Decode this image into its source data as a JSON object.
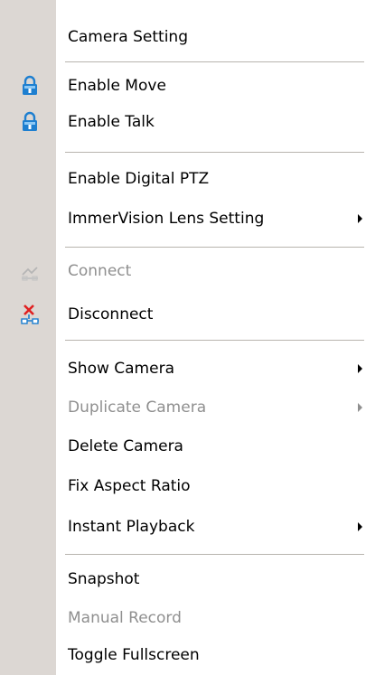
{
  "menu": {
    "items": [
      {
        "label": "Camera Setting"
      },
      {
        "label": "Enable Move",
        "icon": "lock-icon"
      },
      {
        "label": "Enable Talk",
        "icon": "lock-icon"
      },
      {
        "label": "Enable Digital PTZ"
      },
      {
        "label": "ImmerVision Lens Setting",
        "submenu": true
      },
      {
        "label": "Connect",
        "icon": "connect-icon",
        "disabled": true
      },
      {
        "label": "Disconnect",
        "icon": "disconnect-icon"
      },
      {
        "label": "Show Camera",
        "submenu": true
      },
      {
        "label": "Duplicate Camera",
        "submenu": true,
        "disabled": true
      },
      {
        "label": "Delete Camera"
      },
      {
        "label": "Fix Aspect Ratio"
      },
      {
        "label": "Instant Playback",
        "submenu": true
      },
      {
        "label": "Snapshot"
      },
      {
        "label": "Manual Record",
        "disabled": true
      },
      {
        "label": "Toggle Fullscreen"
      }
    ]
  },
  "colors": {
    "gutter": "#dcd7d3",
    "text": "#000000",
    "disabled_text": "#8f8f8f",
    "lock_icon": "#1e7fd0",
    "disconnect_x": "#e02020"
  }
}
